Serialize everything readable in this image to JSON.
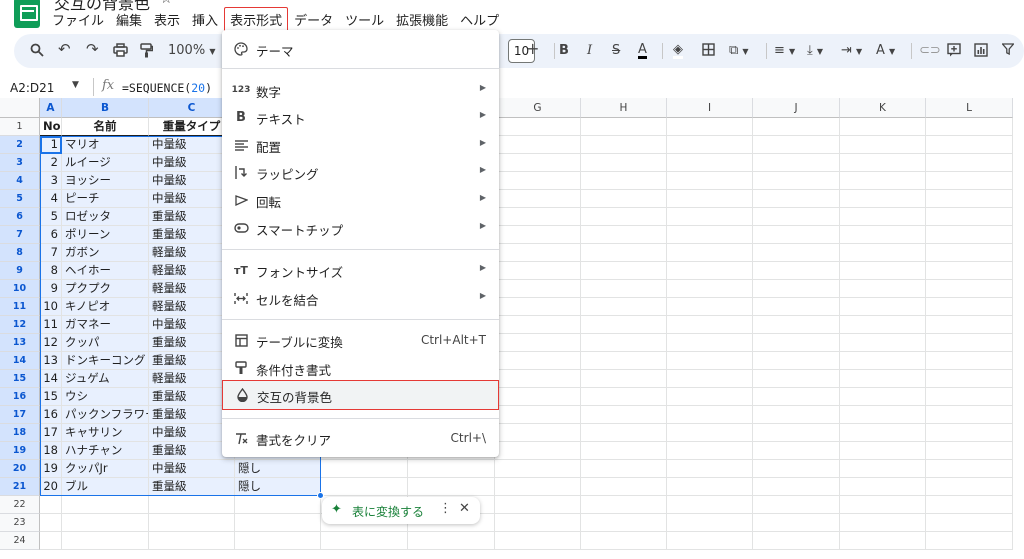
{
  "doc_title": "交互の背景色",
  "menu": [
    "ファイル",
    "編集",
    "表示",
    "挿入",
    "表示形式",
    "データ",
    "ツール",
    "拡張機能",
    "ヘルプ"
  ],
  "menu_highlight": "表示形式",
  "toolbar": {
    "zoom": "100%",
    "font_size": "10"
  },
  "formula_bar": {
    "name_box": "A2:D21",
    "fx": "fx",
    "formula_prefix": "=SEQUENCE(",
    "formula_arg": "20",
    "formula_suffix": ")"
  },
  "columns": [
    "A",
    "B",
    "C",
    "D",
    "E",
    "F",
    "G",
    "H",
    "I",
    "J",
    "K",
    "L"
  ],
  "selected_columns": [
    "A",
    "B",
    "C",
    "D"
  ],
  "header_row": {
    "no": "No",
    "name": "名前",
    "type": "重量タイプ"
  },
  "rows": [
    {
      "no": "1",
      "name": "マリオ",
      "type": "中量級",
      "d": ""
    },
    {
      "no": "2",
      "name": "ルイージ",
      "type": "中量級",
      "d": ""
    },
    {
      "no": "3",
      "name": "ヨッシー",
      "type": "中量級",
      "d": ""
    },
    {
      "no": "4",
      "name": "ピーチ",
      "type": "中量級",
      "d": ""
    },
    {
      "no": "5",
      "name": "ロゼッタ",
      "type": "重量級",
      "d": ""
    },
    {
      "no": "6",
      "name": "ポリーン",
      "type": "重量級",
      "d": ""
    },
    {
      "no": "7",
      "name": "ガボン",
      "type": "軽量級",
      "d": ""
    },
    {
      "no": "8",
      "name": "ヘイホー",
      "type": "軽量級",
      "d": ""
    },
    {
      "no": "9",
      "name": "プクプク",
      "type": "軽量級",
      "d": ""
    },
    {
      "no": "10",
      "name": "キノピオ",
      "type": "軽量級",
      "d": ""
    },
    {
      "no": "11",
      "name": "ガマネー",
      "type": "中量級",
      "d": ""
    },
    {
      "no": "12",
      "name": "クッパ",
      "type": "重量級",
      "d": ""
    },
    {
      "no": "13",
      "name": "ドンキーコング",
      "type": "重量級",
      "d": ""
    },
    {
      "no": "14",
      "name": "ジュゲム",
      "type": "軽量級",
      "d": ""
    },
    {
      "no": "15",
      "name": "ウシ",
      "type": "重量級",
      "d": ""
    },
    {
      "no": "16",
      "name": "パックンフラワー",
      "type": "重量級",
      "d": ""
    },
    {
      "no": "17",
      "name": "キャサリン",
      "type": "中量級",
      "d": ""
    },
    {
      "no": "18",
      "name": "ハナチャン",
      "type": "重量級",
      "d": ""
    },
    {
      "no": "19",
      "name": "クッパJr",
      "type": "中量級",
      "d": "隠し"
    },
    {
      "no": "20",
      "name": "ブル",
      "type": "重量級",
      "d": "隠し"
    }
  ],
  "row_numbers": [
    "1",
    "2",
    "3",
    "4",
    "5",
    "6",
    "7",
    "8",
    "9",
    "10",
    "11",
    "12",
    "13",
    "14",
    "15",
    "16",
    "17",
    "18",
    "19",
    "20",
    "21",
    "22",
    "23",
    "24"
  ],
  "format_menu": {
    "theme": "テーマ",
    "number": "数字",
    "text": "テキスト",
    "align": "配置",
    "wrap": "ラッピング",
    "rotate": "回転",
    "smart_chips": "スマートチップ",
    "font_size": "フォントサイズ",
    "merge": "セルを結合",
    "convert_table": "テーブルに変換",
    "convert_table_shortcut": "Ctrl+Alt+T",
    "conditional": "条件付き書式",
    "alternating": "交互の背景色",
    "clear": "書式をクリア",
    "clear_shortcut": "Ctrl+\\"
  },
  "chip": {
    "label": "表に変換する"
  },
  "colors": {
    "accent": "#1a73e8",
    "highlight_box": "#e53935",
    "chip_green": "#188038",
    "toolbar_bg": "#edf2fa",
    "selection_bg": "#e8f0fe"
  }
}
